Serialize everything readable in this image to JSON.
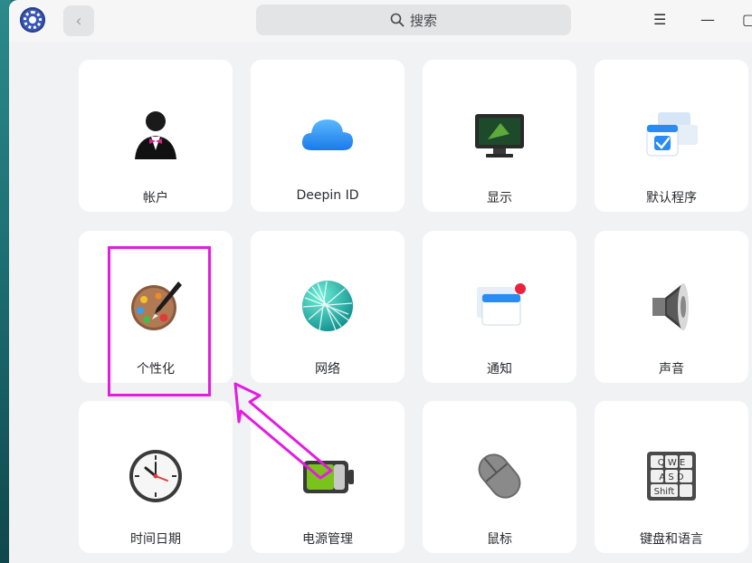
{
  "window": {
    "search_placeholder": "搜索",
    "back_icon": "chevron-left-icon",
    "menu_icon": "☰",
    "minimize_icon": "—",
    "maximize_icon": "▢"
  },
  "modules": [
    {
      "label": "帐户",
      "icon": "account-icon"
    },
    {
      "label": "Deepin ID",
      "icon": "cloud-icon"
    },
    {
      "label": "显示",
      "icon": "monitor-icon"
    },
    {
      "label": "默认程序",
      "icon": "default-apps-icon"
    },
    {
      "label": "个性化",
      "icon": "palette-icon"
    },
    {
      "label": "网络",
      "icon": "network-globe-icon"
    },
    {
      "label": "通知",
      "icon": "notification-icon"
    },
    {
      "label": "声音",
      "icon": "speaker-icon"
    },
    {
      "label": "时间日期",
      "icon": "clock-icon"
    },
    {
      "label": "电源管理",
      "icon": "battery-icon"
    },
    {
      "label": "鼠标",
      "icon": "mouse-icon"
    },
    {
      "label": "键盘和语言",
      "icon": "keyboard-icon"
    }
  ],
  "keyboard_keys": {
    "row1": "QWE",
    "row2": "ASD",
    "row3": "Shift"
  },
  "colors": {
    "highlight": "#e41be0",
    "accent": "#2a8bf2"
  }
}
